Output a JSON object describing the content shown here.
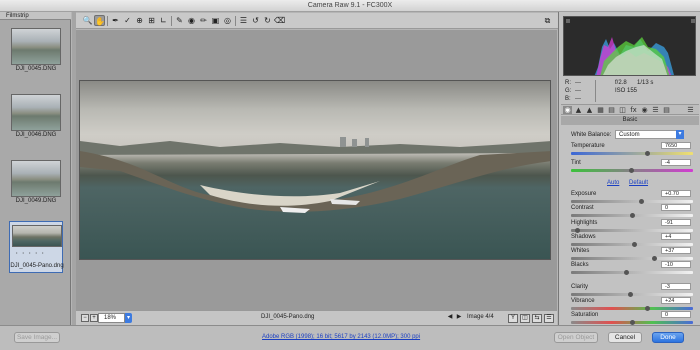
{
  "window": {
    "title": "Camera Raw 9.1  -  FC300X"
  },
  "toolbar": {
    "tools": [
      "zoom-tool",
      "hand-tool",
      "white-balance-tool",
      "color-sampler-tool",
      "targeted-adjustment-tool",
      "crop-tool",
      "straighten-tool",
      "spot-removal-tool",
      "red-eye-tool",
      "adjustment-brush-tool",
      "graduated-filter-tool",
      "radial-filter-tool",
      "preferences-tool",
      "rotate-ccw-tool",
      "rotate-cw-tool",
      "trash-tool"
    ]
  },
  "filmstrip": {
    "title": "Filmstrip",
    "items": [
      {
        "label": "DJI_0045.DNG"
      },
      {
        "label": "DJI_0046.DNG"
      },
      {
        "label": "DJI_0049.DNG"
      },
      {
        "label": "DJI_0045-Pano.dng",
        "selected": true
      }
    ]
  },
  "canvas": {
    "filename": "DJI_0045-Pano.dng",
    "zoom": "18%",
    "image_counter": "Image 4/4"
  },
  "info": {
    "r_label": "R:",
    "g_label": "G:",
    "b_label": "B:",
    "r": "---",
    "g": "---",
    "b": "---",
    "aperture": "f/2.8",
    "shutter": "1/13 s",
    "iso": "ISO 155"
  },
  "panel": {
    "title": "Basic",
    "wb_label": "White Balance:",
    "wb_value": "Custom",
    "auto": "Auto",
    "default": "Default",
    "sliders": [
      {
        "label": "Temperature",
        "value": "7650",
        "frac": 0.62
      },
      {
        "label": "Tint",
        "value": "-4",
        "frac": 0.49
      },
      {
        "label": "Exposure",
        "value": "+0.70",
        "frac": 0.57
      },
      {
        "label": "Contrast",
        "value": "0",
        "frac": 0.5
      },
      {
        "label": "Highlights",
        "value": "-91",
        "frac": 0.05
      },
      {
        "label": "Shadows",
        "value": "+4",
        "frac": 0.52
      },
      {
        "label": "Whites",
        "value": "+37",
        "frac": 0.68
      },
      {
        "label": "Blacks",
        "value": "-10",
        "frac": 0.45
      },
      {
        "label": "Clarity",
        "value": "-3",
        "frac": 0.48
      },
      {
        "label": "Vibrance",
        "value": "+24",
        "frac": 0.62
      },
      {
        "label": "Saturation",
        "value": "0",
        "frac": 0.5
      }
    ]
  },
  "footer": {
    "save": "Save Image...",
    "workflow": "Adobe RGB (1998); 16 bit; 5617 by 2143 (12.0MP); 300 ppi",
    "open": "Open Object",
    "cancel": "Cancel",
    "done": "Done"
  },
  "colors": {
    "accent": "#3d7be0",
    "panel": "#c2c2c2",
    "canvas": "#9a9a9a"
  }
}
